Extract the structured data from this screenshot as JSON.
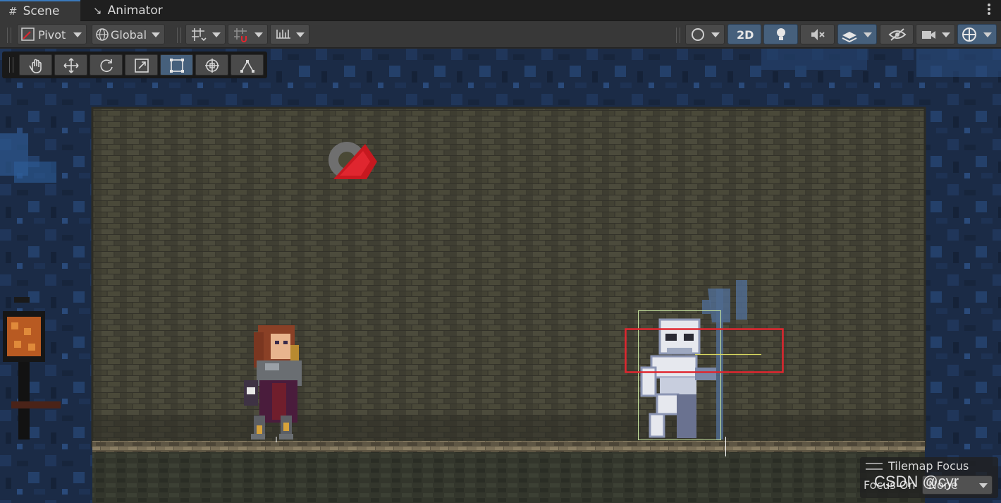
{
  "tabs": [
    {
      "label": "Scene",
      "icon": "grid-hash-icon",
      "active": true
    },
    {
      "label": "Animator",
      "icon": "animator-icon",
      "active": false
    }
  ],
  "toolbar": {
    "pivot_label": "Pivot",
    "global_label": "Global",
    "mode_2d_label": "2D"
  },
  "tools": [
    "hand-tool",
    "move-tool",
    "rotate-tool",
    "scale-tool",
    "rect-tool",
    "transform-tool",
    "custom-tool"
  ],
  "active_tool": "rect-tool",
  "tilemap_overlay": {
    "title": "Tilemap Focus",
    "focus_label": "Focus On",
    "focus_value": "None"
  },
  "watermark": "CSDN @cyr",
  "colors": {
    "accent_blue": "#46607c",
    "selection_red": "#e0262f",
    "cave_blue": "#1a2c47",
    "brick": "#454436"
  }
}
